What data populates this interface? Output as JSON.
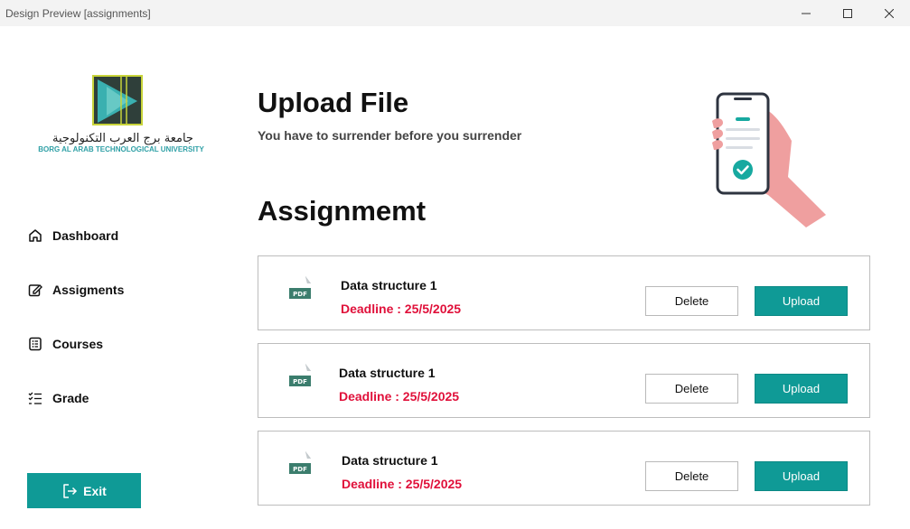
{
  "window": {
    "title": "Design Preview [assignments]",
    "controls": {
      "minimize": "minimize-icon",
      "maximize": "maximize-icon",
      "close": "close-icon"
    }
  },
  "logo": {
    "arabic_name": "جامعة برج العرب التكنولوجية",
    "english_name": "BORG AL ARAB TECHNOLOGICAL UNIVERSITY"
  },
  "sidebar": {
    "items": [
      {
        "label": "Dashboard",
        "icon": "home-icon"
      },
      {
        "label": "Assigments",
        "icon": "edit-icon"
      },
      {
        "label": "Courses",
        "icon": "list-icon"
      },
      {
        "label": "Grade",
        "icon": "checklist-icon"
      }
    ],
    "exit_label": "Exit",
    "exit_icon": "logout-icon"
  },
  "header": {
    "title": "Upload File",
    "subtitle": "You have to surrender before you surrender"
  },
  "section": {
    "title": "Assignmemt"
  },
  "assignments": [
    {
      "name": "Data structure 1",
      "deadline": "Deadline : 25/5/2025",
      "file_badge": "PDF",
      "delete_label": "Delete",
      "upload_label": "Upload"
    },
    {
      "name": "Data structure 1",
      "deadline": "Deadline : 25/5/2025",
      "file_badge": "PDF",
      "delete_label": "Delete",
      "upload_label": "Upload"
    },
    {
      "name": "Data structure 1",
      "deadline": "Deadline : 25/5/2025",
      "file_badge": "PDF",
      "delete_label": "Delete",
      "upload_label": "Upload"
    }
  ],
  "colors": {
    "accent": "#0f9a96",
    "deadline": "#e0103a",
    "hand": "#ef9f9f"
  }
}
